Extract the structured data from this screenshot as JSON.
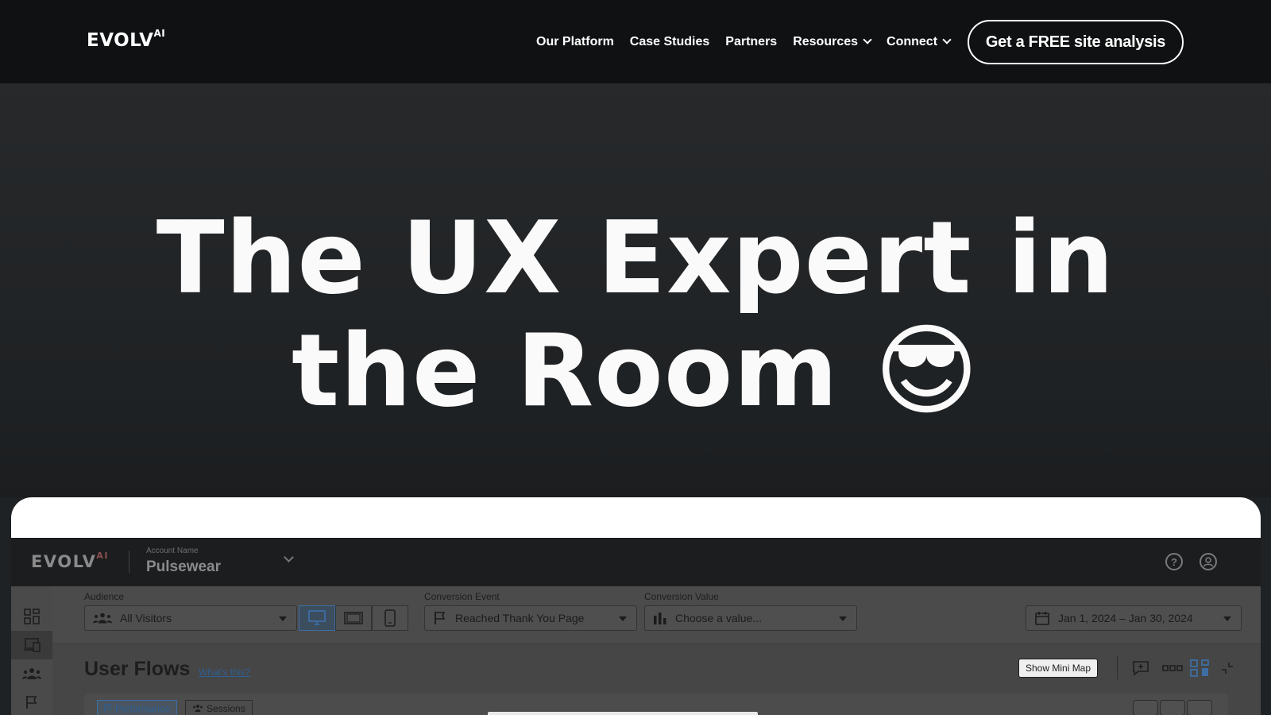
{
  "nav": {
    "logo": "EVOLV",
    "logo_sup": "AI",
    "links": [
      {
        "label": "Our Platform"
      },
      {
        "label": "Case Studies"
      },
      {
        "label": "Partners"
      },
      {
        "label": "Resources"
      },
      {
        "label": "Connect"
      }
    ],
    "cta_label": "Get a FREE site analysis"
  },
  "hero": {
    "title": "The UX Expert in the Room 😎"
  },
  "app": {
    "logo": "EVOLV",
    "logo_sup": "AI",
    "account_label": "Account Name",
    "account_name": "Pulsewear",
    "filters": {
      "audience_label": "Audience",
      "audience_value": "All Visitors",
      "conversion_event_label": "Conversion Event",
      "conversion_event_value": "Reached Thank You Page",
      "conversion_value_label": "Conversion Value",
      "conversion_value_placeholder": "Choose a value...",
      "date_range": "Jan 1, 2024 – Jan 30, 2024"
    },
    "content": {
      "title": "User Flows",
      "whats_this": "What's this?",
      "show_mini_map": "Show Mini Map",
      "tabs": [
        {
          "label": "Performance"
        },
        {
          "label": "Sessions"
        }
      ]
    }
  },
  "colors": {
    "nav_bg": "#0f1112",
    "hero_bg": "#222527",
    "accent_blue": "#3d6ea3",
    "logo_ai_red": "#8c4f50"
  }
}
